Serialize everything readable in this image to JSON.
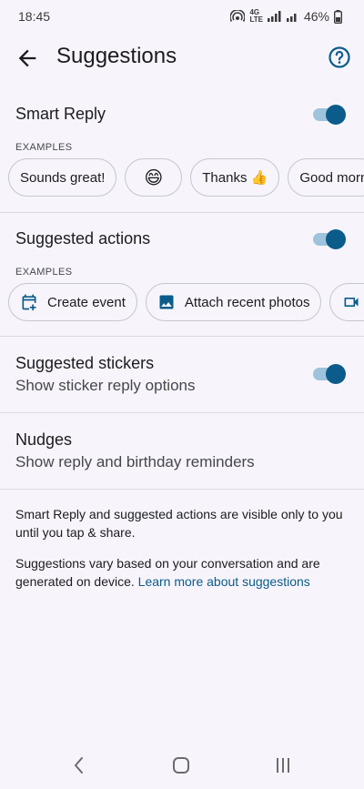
{
  "status": {
    "time": "18:45",
    "network_top": "4G",
    "network_bottom": "LTE",
    "battery": "46%"
  },
  "header": {
    "title": "Suggestions"
  },
  "smart_reply": {
    "title": "Smart Reply",
    "enabled": true,
    "examples_label": "EXAMPLES",
    "chips": [
      "Sounds great!",
      "😄",
      "Thanks 👍",
      "Good morn"
    ]
  },
  "suggested_actions": {
    "title": "Suggested actions",
    "enabled": true,
    "examples_label": "EXAMPLES",
    "chips": [
      {
        "label": "Create event",
        "icon": "calendar-add-icon"
      },
      {
        "label": "Attach recent photos",
        "icon": "image-icon"
      },
      {
        "label": "",
        "icon": "video-icon"
      }
    ]
  },
  "stickers": {
    "title": "Suggested stickers",
    "subtitle": "Show sticker reply options",
    "enabled": true
  },
  "nudges": {
    "title": "Nudges",
    "subtitle": "Show reply and birthday reminders"
  },
  "footer": {
    "privacy_note": "Smart Reply and suggested actions are visible only to you until you tap & share.",
    "info_note": "Suggestions vary based on your conversation and are generated on device.",
    "learn_more": "Learn more about suggestions"
  },
  "colors": {
    "accent": "#0b5c8a",
    "toggle_track": "#9fc3dd",
    "background": "#f7f5fb"
  }
}
